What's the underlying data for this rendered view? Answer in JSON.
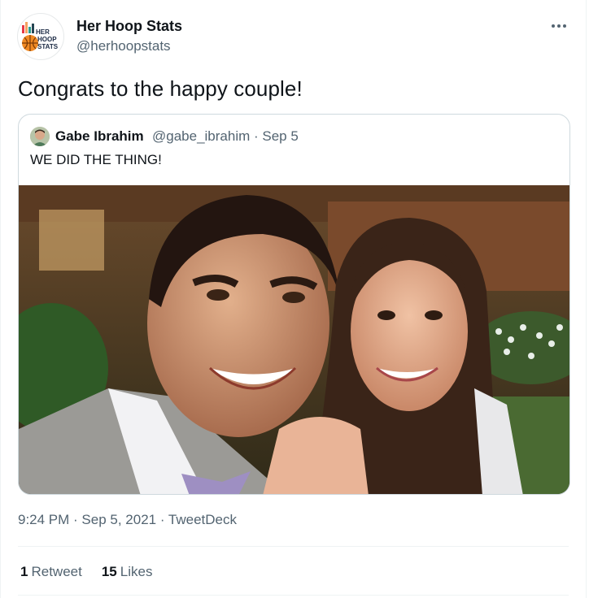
{
  "tweet": {
    "author_name": "Her Hoop Stats",
    "author_handle": "@herhoopstats",
    "avatar_logo": "HER HOOP STATS",
    "text": "Congrats to the happy couple!",
    "timestamp": "9:24 PM · Sep 5, 2021 · TweetDeck",
    "retweet_count": "1",
    "retweet_label": "Retweet",
    "like_count": "15",
    "like_label": "Likes"
  },
  "quoted": {
    "name": "Gabe Ibrahim",
    "meta": "@gabe_ibrahim · Sep 5",
    "text": "WE DID THE THING!"
  },
  "icons": {
    "more": "more-horizontal-icon"
  },
  "colors": {
    "text": "#0f1419",
    "secondary": "#536471",
    "border": "#cfd9de"
  }
}
